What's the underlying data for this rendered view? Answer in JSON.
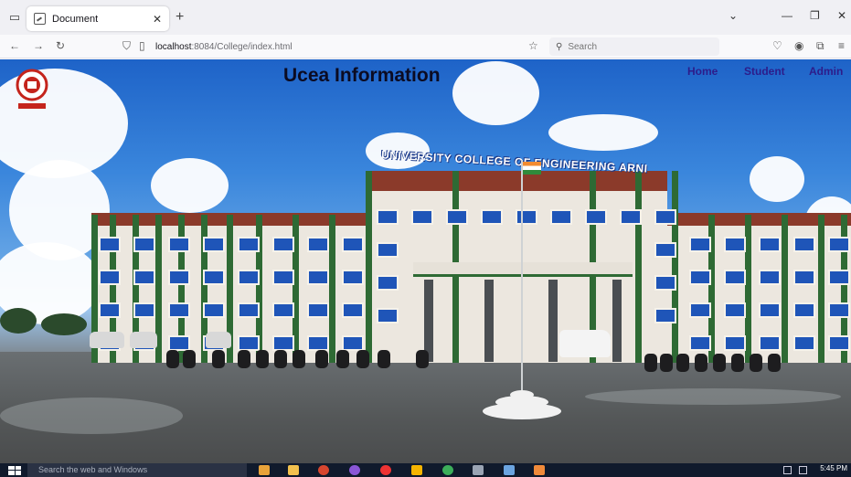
{
  "browser": {
    "tab_title": "Document",
    "close_tab_symbol": "✕",
    "new_tab_symbol": "+",
    "url_host": "localhost",
    "url_rest": ":8084/College/index.html",
    "search_placeholder": "Search"
  },
  "site": {
    "title": "Ucea Information",
    "nav": [
      "Home",
      "Student",
      "Admin"
    ],
    "building_sign": "UNIVERSITY COLLEGE OF ENGINEERING ARNI"
  },
  "taskbar": {
    "search_placeholder": "Search the web and Windows",
    "time": "5:45 PM"
  },
  "icons": [
    "tab-list-icon",
    "document-favicon",
    "back-icon",
    "forward-icon",
    "reload-icon",
    "shield-icon",
    "page-icon",
    "bookmark-star-icon",
    "search-icon",
    "pocket-icon",
    "account-icon",
    "extensions-icon",
    "menu-icon",
    "minimize-icon",
    "restore-icon",
    "close-window-icon",
    "windows-start-icon",
    "college-logo"
  ]
}
